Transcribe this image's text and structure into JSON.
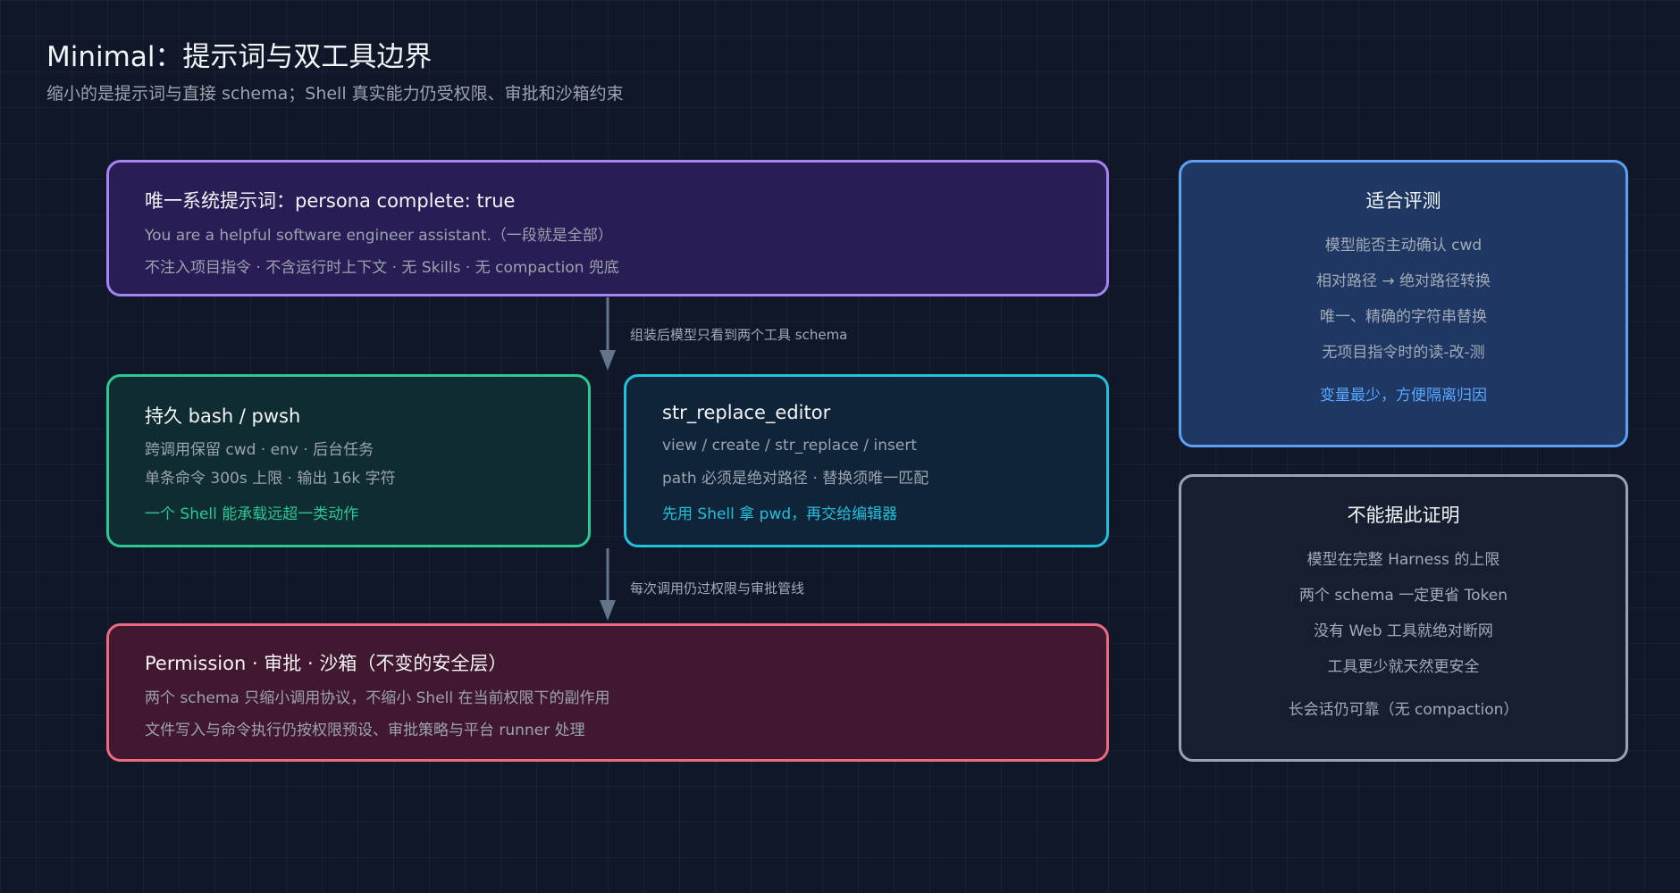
{
  "header": {
    "title": "Minimal：提示词与双工具边界",
    "subtitle": "缩小的是提示词与直接 schema；Shell 真实能力仍受权限、审批和沙箱约束"
  },
  "prompt_box": {
    "title": "唯一系统提示词：persona complete: true",
    "line1": "You are a helpful software engineer assistant.（一段就是全部）",
    "line2": "不注入项目指令 · 不含运行时上下文 · 无 Skills · 无 compaction 兜底"
  },
  "arrow1_label": "组装后模型只看到两个工具 schema",
  "bash_box": {
    "title": "持久 bash / pwsh",
    "line1": "跨调用保留 cwd · env · 后台任务",
    "line2": "单条命令 300s 上限 · 输出 16k 字符",
    "accent": "一个 Shell 能承载远超一类动作"
  },
  "editor_box": {
    "title": "str_replace_editor",
    "line1": "view / create / str_replace / insert",
    "line2": "path 必须是绝对路径 · 替换须唯一匹配",
    "accent": "先用 Shell 拿 pwd，再交给编辑器"
  },
  "arrow2_label": "每次调用仍过权限与审批管线",
  "perm_box": {
    "title": "Permission · 审批 · 沙箱（不变的安全层）",
    "line1": "两个 schema 只缩小调用协议，不缩小 Shell 在当前权限下的副作用",
    "line2": "文件写入与命令执行仍按权限预设、审批策略与平台 runner 处理"
  },
  "fit_box": {
    "title": "适合评测",
    "items": [
      "模型能否主动确认 cwd",
      "相对路径 → 绝对路径转换",
      "唯一、精确的字符串替换",
      "无项目指令时的读-改-测"
    ],
    "accent": "变量最少，方便隔离归因"
  },
  "no_box": {
    "title": "不能据此证明",
    "items": [
      "模型在完整 Harness 的上限",
      "两个 schema 一定更省 Token",
      "没有 Web 工具就绝对断网",
      "工具更少就天然更安全",
      "长会话仍可靠（无 compaction）"
    ]
  },
  "colors": {
    "background": "#0f1729",
    "prompt_border": "#a684f3",
    "bash_border": "#2dc793",
    "editor_border": "#22c0db",
    "perm_border": "#ec6a7d",
    "fit_border": "#5da1f3",
    "fit_accent": "#5aa7ff",
    "no_border": "#9aa3b3",
    "arrow": "#64748b"
  }
}
